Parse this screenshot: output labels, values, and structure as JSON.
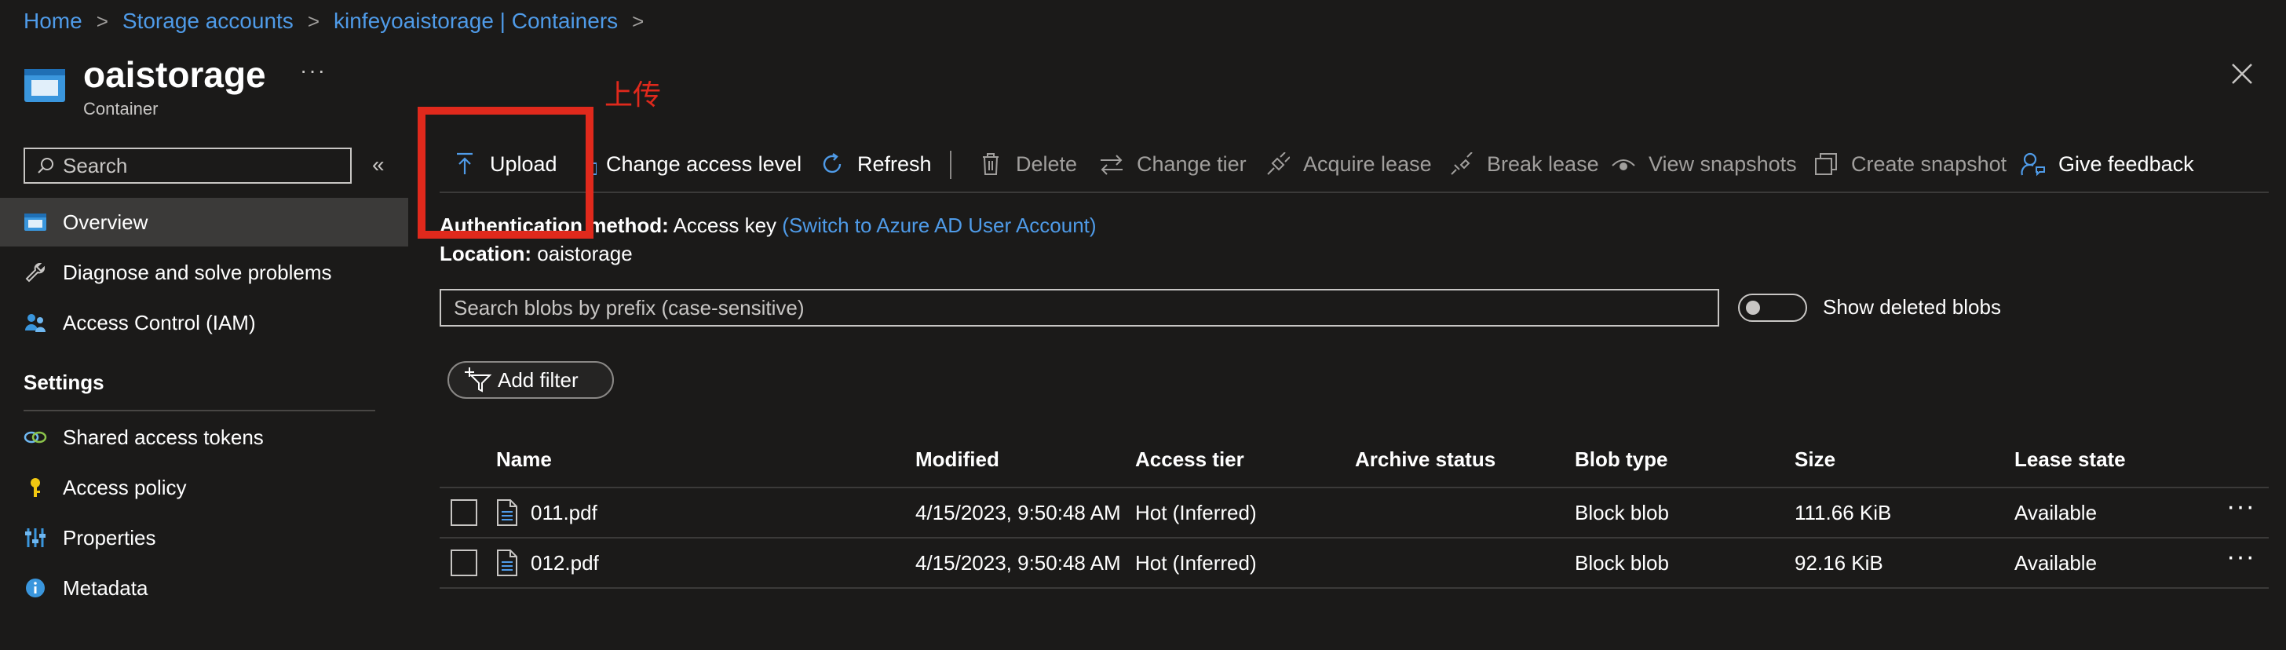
{
  "breadcrumb": [
    "Home",
    "Storage accounts",
    "kinfeyoaistorage | Containers"
  ],
  "header": {
    "title": "oaistorage",
    "subtitle": "Container",
    "more": "···"
  },
  "annotation": {
    "text": "上传",
    "color": "#e0291c"
  },
  "sidebar": {
    "search_placeholder": "Search",
    "collapse": "«",
    "items": [
      {
        "label": "Overview",
        "icon": "container-icon",
        "active": true
      },
      {
        "label": "Diagnose and solve problems",
        "icon": "wrench-icon"
      },
      {
        "label": "Access Control (IAM)",
        "icon": "people-icon"
      }
    ],
    "settings_header": "Settings",
    "settings_items": [
      {
        "label": "Shared access tokens",
        "icon": "link-icon"
      },
      {
        "label": "Access policy",
        "icon": "key-icon"
      },
      {
        "label": "Properties",
        "icon": "sliders-icon"
      },
      {
        "label": "Metadata",
        "icon": "info-icon"
      }
    ]
  },
  "toolbar": {
    "upload": "Upload",
    "change_access_level": "Change access level",
    "refresh": "Refresh",
    "delete": "Delete",
    "change_tier": "Change tier",
    "acquire_lease": "Acquire lease",
    "break_lease": "Break lease",
    "view_snapshots": "View snapshots",
    "create_snapshot": "Create snapshot",
    "give_feedback": "Give feedback"
  },
  "info": {
    "auth_label": "Authentication method:",
    "auth_value": "Access key",
    "auth_link": "(Switch to Azure AD User Account)",
    "location_label": "Location:",
    "location_value": "oaistorage"
  },
  "blob_search": {
    "placeholder": "Search blobs by prefix (case-sensitive)"
  },
  "show_deleted": {
    "label": "Show deleted blobs",
    "on": false
  },
  "add_filter": "Add filter",
  "table": {
    "columns": [
      "Name",
      "Modified",
      "Access tier",
      "Archive status",
      "Blob type",
      "Size",
      "Lease state"
    ],
    "rows": [
      {
        "name": "011.pdf",
        "modified": "4/15/2023, 9:50:48 AM",
        "access_tier": "Hot (Inferred)",
        "archive_status": "",
        "blob_type": "Block blob",
        "size": "111.66 KiB",
        "lease_state": "Available"
      },
      {
        "name": "012.pdf",
        "modified": "4/15/2023, 9:50:48 AM",
        "access_tier": "Hot (Inferred)",
        "archive_status": "",
        "blob_type": "Block blob",
        "size": "92.16 KiB",
        "lease_state": "Available"
      }
    ],
    "row_more": "···"
  },
  "colors": {
    "background": "#1b1a19",
    "link": "#4f9be8",
    "accent_icon": "#4f9be8",
    "annotation": "#e0291c"
  }
}
